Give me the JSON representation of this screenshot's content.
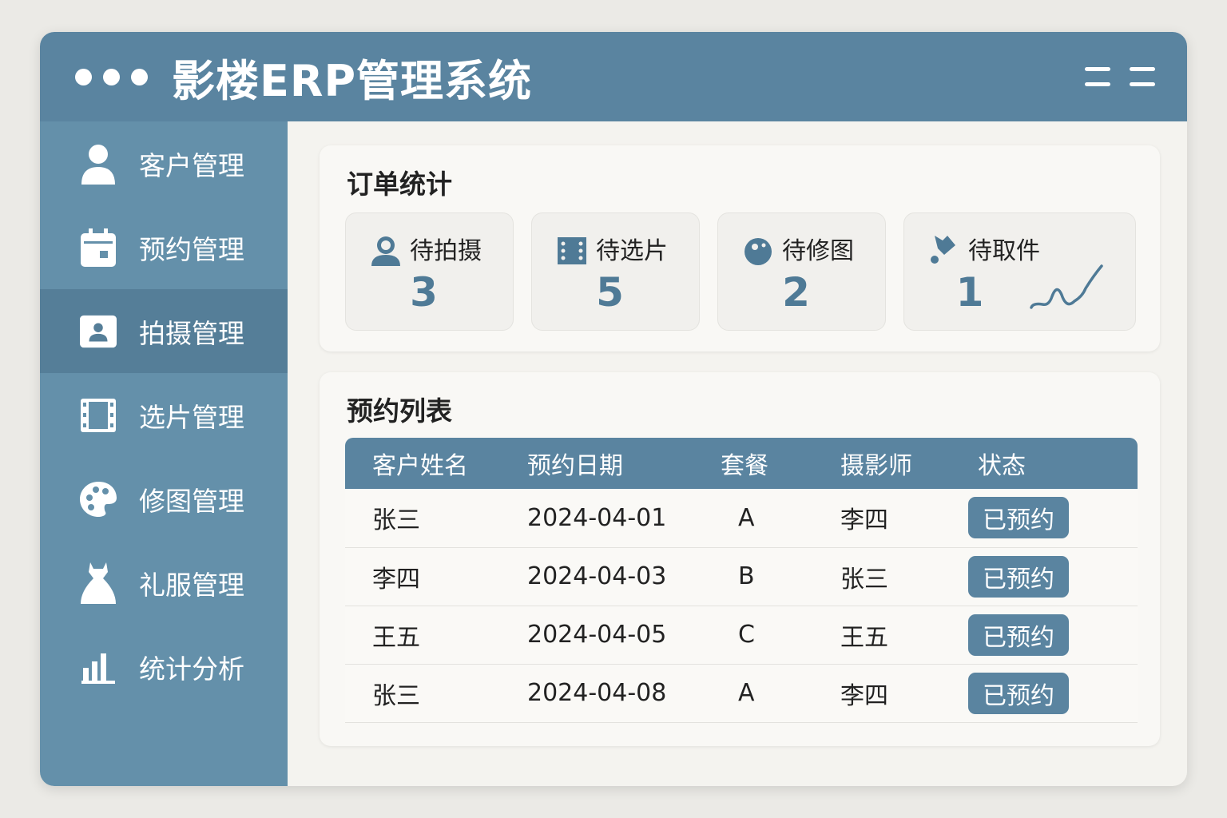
{
  "app": {
    "title": "影楼ERP管理系统"
  },
  "sidebar": {
    "items": [
      {
        "label": "客户管理",
        "icon": "user-icon"
      },
      {
        "label": "预约管理",
        "icon": "calendar-icon"
      },
      {
        "label": "拍摄管理",
        "icon": "portrait-icon",
        "active": true
      },
      {
        "label": "选片管理",
        "icon": "film-icon"
      },
      {
        "label": "修图管理",
        "icon": "palette-icon"
      },
      {
        "label": "礼服管理",
        "icon": "dress-icon"
      },
      {
        "label": "统计分析",
        "icon": "bar-chart-icon"
      }
    ]
  },
  "stats": {
    "title": "订单统计",
    "cards": [
      {
        "label": "待拍摄",
        "value": "3"
      },
      {
        "label": "待选片",
        "value": "5"
      },
      {
        "label": "待修图",
        "value": "2"
      },
      {
        "label": "待取件",
        "value": "1"
      }
    ]
  },
  "appointments": {
    "title": "预约列表",
    "columns": [
      "客户姓名",
      "预约日期",
      "套餐",
      "摄影师",
      "状态"
    ],
    "rows": [
      [
        "张三",
        "2024-04-01",
        "A",
        "李四",
        "已预约"
      ],
      [
        "李四",
        "2024-04-03",
        "B",
        "张三",
        "已预约"
      ],
      [
        "王五",
        "2024-04-05",
        "C",
        "王五",
        "已预约"
      ],
      [
        "张三",
        "2024-04-08",
        "A",
        "李四",
        "已预约"
      ]
    ]
  },
  "colors": {
    "accent": "#5a84a0",
    "sidebar": "#6490aa",
    "sidebar_active": "#557e98"
  }
}
